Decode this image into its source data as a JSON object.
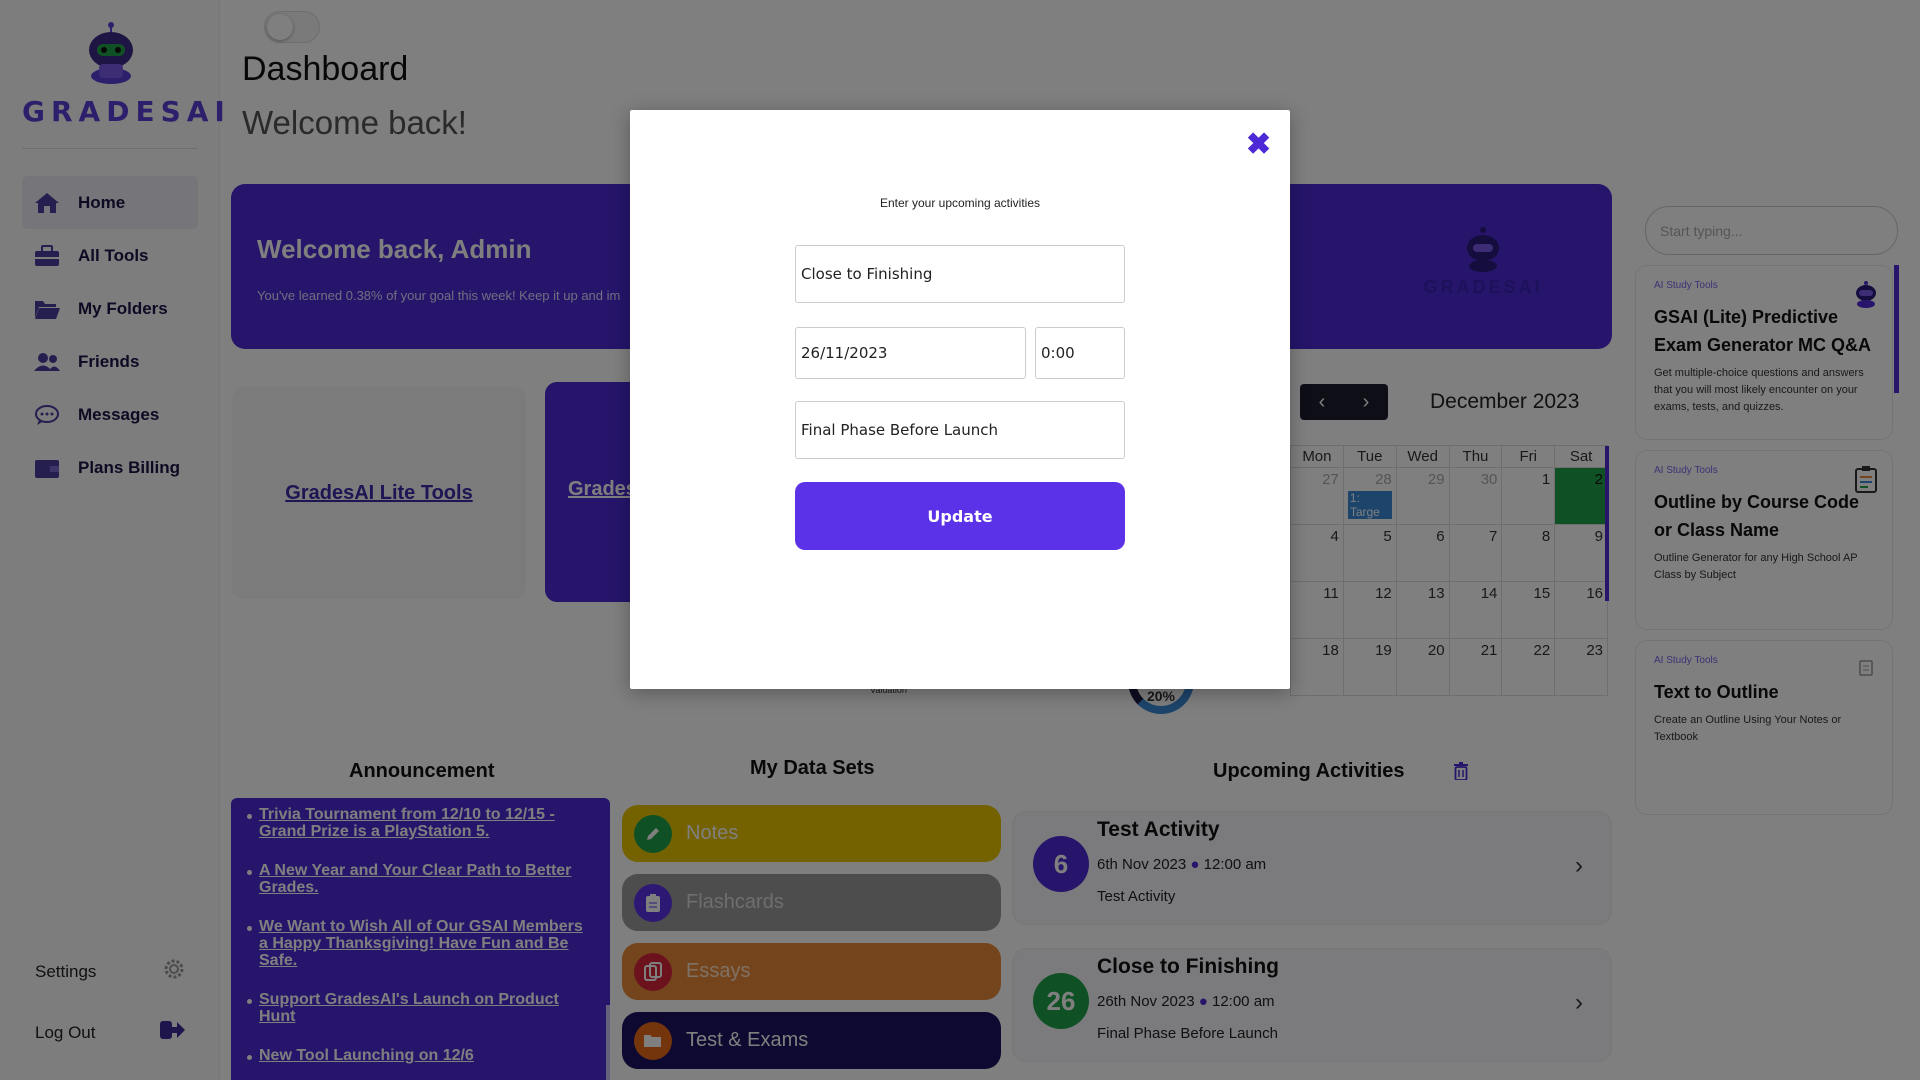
{
  "brand": {
    "name": "GRADESAI",
    "color": "#5b3fd6"
  },
  "sidebar": {
    "items": [
      {
        "label": "Home",
        "icon": "home-icon"
      },
      {
        "label": "All Tools",
        "icon": "toolbox-icon"
      },
      {
        "label": "My Folders",
        "icon": "folder-open-icon"
      },
      {
        "label": "Friends",
        "icon": "users-icon"
      },
      {
        "label": "Messages",
        "icon": "chat-bubble-icon"
      },
      {
        "label": "Plans Billing",
        "icon": "wallet-icon"
      }
    ],
    "settings_label": "Settings",
    "logout_label": "Log Out"
  },
  "header": {
    "title": "Dashboard",
    "subtitle": "Welcome back!"
  },
  "banner": {
    "greeting": "Welcome back, Admin",
    "progress_text": "You've learned 0.38%  of your goal this week! Keep it up and im",
    "logo_text": "GRADESAI"
  },
  "tools": {
    "lite_link": "GradesAI Lite Tools",
    "second_link": "Grades"
  },
  "calendar": {
    "month": "December 2023",
    "weekdays": [
      "Mon",
      "Tue",
      "Wed",
      "Thu",
      "Fri",
      "Sat"
    ],
    "weeks": [
      [
        "27",
        "28",
        "29",
        "30",
        "1",
        "2"
      ],
      [
        "4",
        "5",
        "6",
        "7",
        "8",
        "9"
      ],
      [
        "11",
        "12",
        "13",
        "14",
        "15",
        "16"
      ],
      [
        "18",
        "19",
        "20",
        "21",
        "22",
        "23"
      ]
    ],
    "event_label": "1: Targe",
    "highlight_color": "#1fa34a"
  },
  "search": {
    "placeholder": "Start typing..."
  },
  "ai_tools": [
    {
      "tag": "AI Study Tools",
      "title": "GSAI (Lite) Predictive Exam Generator MC Q&A",
      "desc": "Get multiple-choice questions and answers that you will most likely encounter on your exams, tests, and quizzes."
    },
    {
      "tag": "AI Study Tools",
      "title": "Outline by Course Code or Class Name",
      "desc": "Outline Generator for any High School AP Class by Subject"
    },
    {
      "tag": "AI Study Tools",
      "title": "Text to Outline",
      "desc": "Create an Outline Using Your Notes or Textbook"
    }
  ],
  "announcement": {
    "title": "Announcement",
    "items": [
      "Trivia Tournament from 12/10 to 12/15 - Grand Prize is a PlayStation 5.",
      "A New Year and Your Clear Path to Better Grades.",
      "We Want to Wish All of Our GSAI Members a Happy Thanksgiving!  Have Fun and Be Safe.",
      "Support GradesAI's Launch on Product Hunt",
      "New Tool Launching on 12/6"
    ]
  },
  "datasets": {
    "title": "My Data Sets",
    "items": [
      {
        "label": "Notes",
        "color": "#e8c200",
        "icon_color": "#1fa34a"
      },
      {
        "label": "Flashcards",
        "color": "#9a9a9a",
        "icon_color": "#5b32e8"
      },
      {
        "label": "Essays",
        "color": "#e88a3a",
        "icon_color": "#d8243a"
      },
      {
        "label": "Test & Exams",
        "color": "#1a1260",
        "icon_color": "#e86a1a"
      }
    ]
  },
  "activities": {
    "title": "Upcoming Activities",
    "items": [
      {
        "day": "6",
        "title": "Test Activity",
        "date": "6th Nov 2023",
        "time": "12:00 am",
        "desc": "Test Activity",
        "color": "#4d2ad6"
      },
      {
        "day": "26",
        "title": "Close to Finishing",
        "date": "26th Nov 2023",
        "time": "12:00 am",
        "desc": "Final Phase Before Launch",
        "color": "#1fa34a"
      }
    ]
  },
  "background_text": {
    "valuation": "Valuation",
    "percent": "20%"
  },
  "modal": {
    "label": "Enter your upcoming activities",
    "title_value": "Close to Finishing",
    "date_value": "26/11/2023",
    "time_value": "0:00",
    "desc_value": "Final Phase Before Launch",
    "button_label": "Update",
    "close_icon": "close-icon",
    "accent": "#5b32e8"
  }
}
